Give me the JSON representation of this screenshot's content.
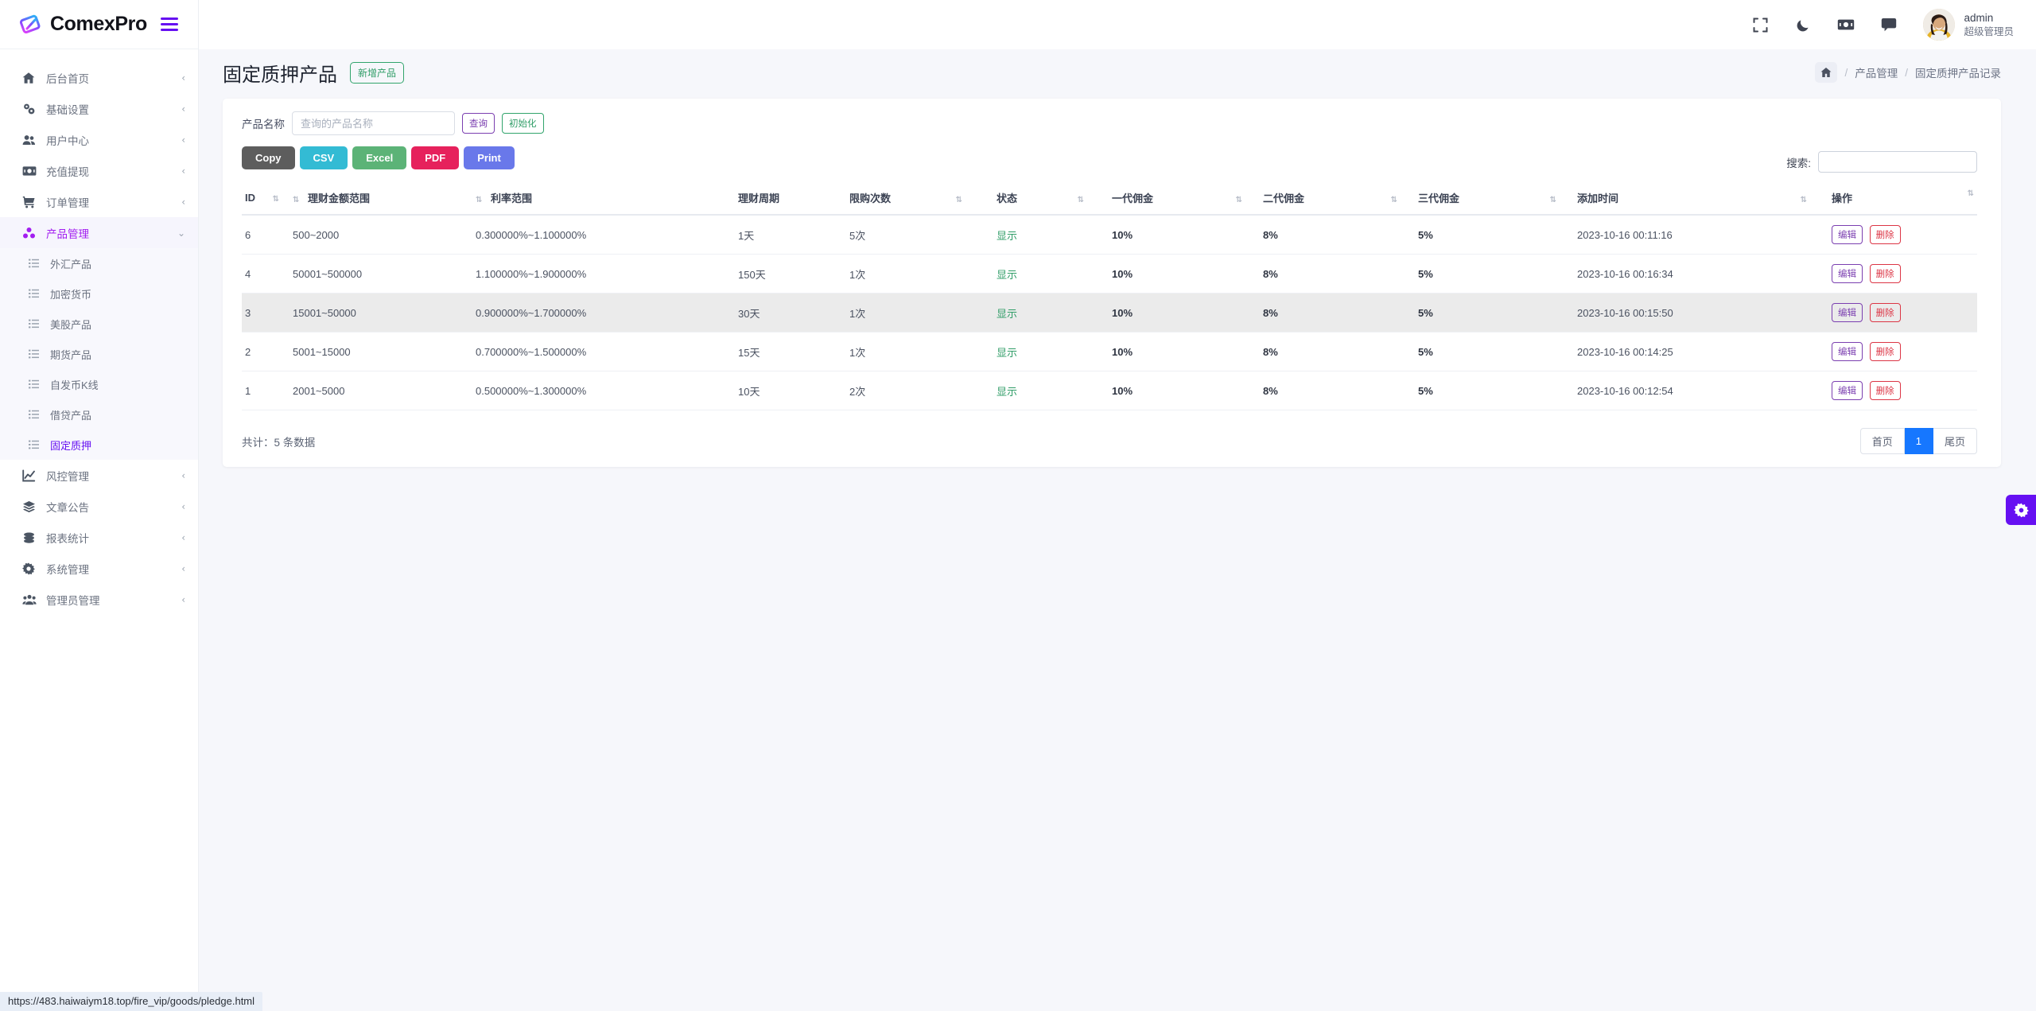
{
  "brand": {
    "name": "ComexPro",
    "logo_icon": "comexpro-logo-icon",
    "menu_toggle_icon": "hamburger-icon"
  },
  "topbar": {
    "icons": [
      {
        "name": "fullscreen-icon",
        "label": "全屏"
      },
      {
        "name": "moon-icon",
        "label": "深色模式"
      },
      {
        "name": "money-icon",
        "label": "财务"
      },
      {
        "name": "chat-icon",
        "label": "消息"
      }
    ],
    "user": {
      "name": "admin",
      "role": "超级管理员",
      "avatar_icon": "user-avatar"
    }
  },
  "sidebar": {
    "items": [
      {
        "label": "后台首页",
        "icon": "home-icon",
        "arrow": "‹",
        "state": "normal"
      },
      {
        "label": "基础设置",
        "icon": "settings-gears-icon",
        "arrow": "‹",
        "state": "normal"
      },
      {
        "label": "用户中心",
        "icon": "users-icon",
        "arrow": "‹",
        "state": "normal"
      },
      {
        "label": "充值提现",
        "icon": "money-icon",
        "arrow": "‹",
        "state": "normal"
      },
      {
        "label": "订单管理",
        "icon": "cart-icon",
        "arrow": "‹",
        "state": "normal"
      },
      {
        "label": "产品管理",
        "icon": "cubes-icon",
        "arrow": "⌄",
        "state": "active-parent"
      }
    ],
    "submenu": [
      {
        "label": "外汇产品",
        "icon": "list-icon",
        "state": "normal"
      },
      {
        "label": "加密货币",
        "icon": "list-icon",
        "state": "normal"
      },
      {
        "label": "美股产品",
        "icon": "list-icon",
        "state": "normal"
      },
      {
        "label": "期货产品",
        "icon": "list-icon",
        "state": "normal"
      },
      {
        "label": "自发币K线",
        "icon": "list-icon",
        "state": "normal"
      },
      {
        "label": "借贷产品",
        "icon": "list-icon",
        "state": "normal"
      },
      {
        "label": "固定质押",
        "icon": "list-icon",
        "state": "active"
      }
    ],
    "items_after": [
      {
        "label": "风控管理",
        "icon": "chart-line-icon",
        "arrow": "‹",
        "state": "normal"
      },
      {
        "label": "文章公告",
        "icon": "layers-icon",
        "arrow": "‹",
        "state": "normal"
      },
      {
        "label": "报表统计",
        "icon": "coins-icon",
        "arrow": "‹",
        "state": "normal"
      },
      {
        "label": "系统管理",
        "icon": "gear-icon",
        "arrow": "‹",
        "state": "normal"
      },
      {
        "label": "管理员管理",
        "icon": "admin-users-icon",
        "arrow": "‹",
        "state": "normal"
      }
    ]
  },
  "page": {
    "title": "固定质押产品",
    "add_button": "新增产品",
    "breadcrumb": {
      "home_icon": "home-icon",
      "sep": "/",
      "items": [
        "产品管理",
        "固定质押产品记录"
      ]
    }
  },
  "filter": {
    "label": "产品名称",
    "placeholder": "查询的产品名称",
    "value": "",
    "query_button": "查询",
    "reset_button": "初始化"
  },
  "export_buttons": [
    {
      "label": "Copy",
      "color": "#5d5d5d"
    },
    {
      "label": "CSV",
      "color": "#33bbd4"
    },
    {
      "label": "Excel",
      "color": "#5cb377"
    },
    {
      "label": "PDF",
      "color": "#e6215c"
    },
    {
      "label": "Print",
      "color": "#6978ea"
    }
  ],
  "search": {
    "label": "搜索:",
    "value": "",
    "placeholder": ""
  },
  "table": {
    "columns": [
      "ID",
      "理财金额范围",
      "利率范围",
      "理财周期",
      "限购次数",
      "状态",
      "一代佣金",
      "二代佣金",
      "三代佣金",
      "添加时间",
      "操作"
    ],
    "sort_icon": "⇅",
    "rows": [
      {
        "id": "6",
        "amount_range": "500~2000",
        "rate_range": "0.300000%~1.100000%",
        "period": "1天",
        "limit": "5次",
        "status": "显示",
        "c1": "10%",
        "c2": "8%",
        "c3": "5%",
        "created": "2023-10-16 00:11:16",
        "edit": "编辑",
        "delete": "删除",
        "highlight": false
      },
      {
        "id": "4",
        "amount_range": "50001~500000",
        "rate_range": "1.100000%~1.900000%",
        "period": "150天",
        "limit": "1次",
        "status": "显示",
        "c1": "10%",
        "c2": "8%",
        "c3": "5%",
        "created": "2023-10-16 00:16:34",
        "edit": "编辑",
        "delete": "删除",
        "highlight": false
      },
      {
        "id": "3",
        "amount_range": "15001~50000",
        "rate_range": "0.900000%~1.700000%",
        "period": "30天",
        "limit": "1次",
        "status": "显示",
        "c1": "10%",
        "c2": "8%",
        "c3": "5%",
        "created": "2023-10-16 00:15:50",
        "edit": "编辑",
        "delete": "删除",
        "highlight": true
      },
      {
        "id": "2",
        "amount_range": "5001~15000",
        "rate_range": "0.700000%~1.500000%",
        "period": "15天",
        "limit": "1次",
        "status": "显示",
        "c1": "10%",
        "c2": "8%",
        "c3": "5%",
        "created": "2023-10-16 00:14:25",
        "edit": "编辑",
        "delete": "删除",
        "highlight": false
      },
      {
        "id": "1",
        "amount_range": "2001~5000",
        "rate_range": "0.500000%~1.300000%",
        "period": "10天",
        "limit": "2次",
        "status": "显示",
        "c1": "10%",
        "c2": "8%",
        "c3": "5%",
        "created": "2023-10-16 00:12:54",
        "edit": "编辑",
        "delete": "删除",
        "highlight": false
      }
    ],
    "total_text": "共计：5 条数据"
  },
  "pagination": {
    "first": "首页",
    "current": "1",
    "last": "尾页"
  },
  "fab": {
    "icon": "gear-icon"
  },
  "statusbar": {
    "url": "https://483.haiwaiym18.top/fire_vip/goods/pledge.html"
  },
  "colors": {
    "brand_purple": "#6610f2",
    "active_purple": "#a21ef0",
    "green": "#2e9c66",
    "danger": "#dc3545",
    "page_bg": "#f6f7fb",
    "pager_active": "#1677ff"
  }
}
